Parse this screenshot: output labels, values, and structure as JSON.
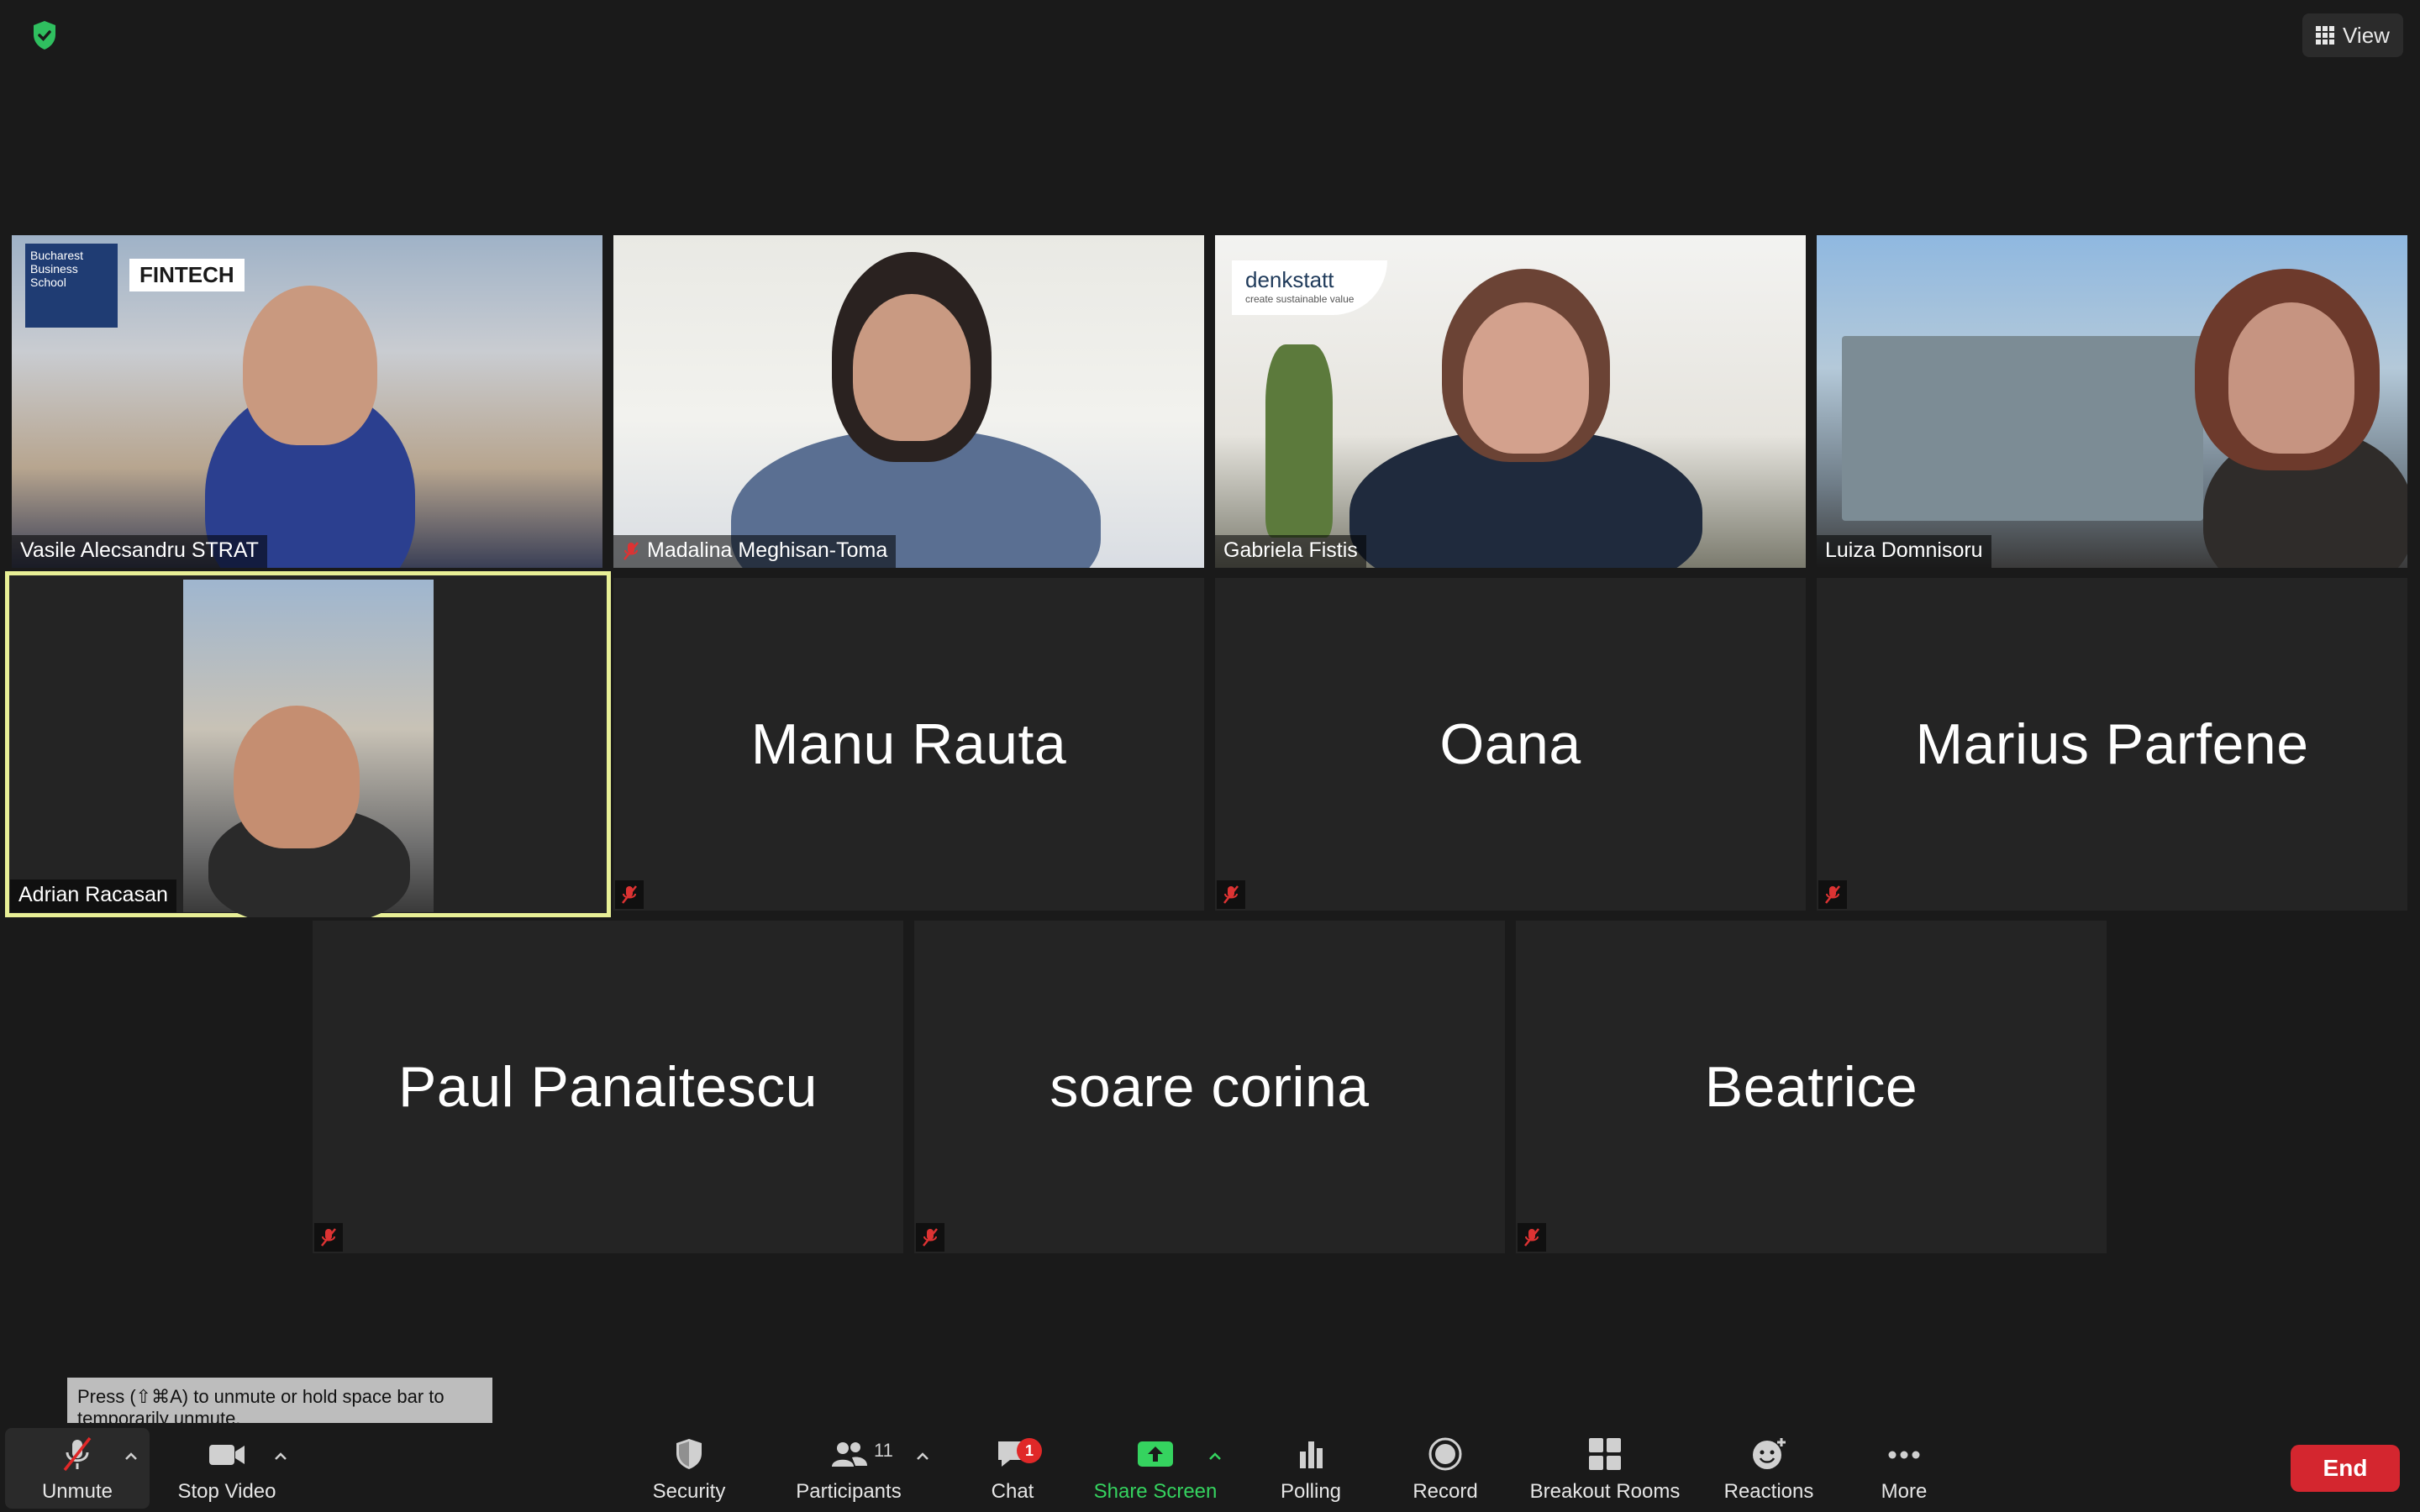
{
  "top": {
    "view_label": "View"
  },
  "participants": [
    {
      "name": "Vasile Alecsandru STRAT",
      "video": true,
      "muted": false
    },
    {
      "name": "Madalina Meghisan-Toma",
      "video": true,
      "muted": true
    },
    {
      "name": "Gabriela Fistis",
      "video": true,
      "muted": false
    },
    {
      "name": "Luiza Domnisoru",
      "video": true,
      "muted": false
    },
    {
      "name": "Adrian Racasan",
      "video": true,
      "muted": false,
      "active_speaker": true
    },
    {
      "name": "Manu Rauta",
      "video": false,
      "muted": true
    },
    {
      "name": "Oana",
      "video": false,
      "muted": true
    },
    {
      "name": "Marius Parfene",
      "video": false,
      "muted": true
    },
    {
      "name": "Paul Panaitescu",
      "video": false,
      "muted": true
    },
    {
      "name": "soare corina",
      "video": false,
      "muted": true
    },
    {
      "name": "Beatrice",
      "video": false,
      "muted": true
    }
  ],
  "video_text": {
    "school_logo": "Bucharest Business School",
    "fintech_logo": "FINTECH",
    "denkstatt_logo": "denkstatt",
    "denkstatt_tagline": "create sustainable value"
  },
  "tooltip": {
    "text": "Press (⇧⌘A) to unmute or hold space bar to temporarily unmute."
  },
  "toolbar": {
    "unmute": "Unmute",
    "stop_video": "Stop Video",
    "security": "Security",
    "participants": "Participants",
    "participants_count": "11",
    "chat": "Chat",
    "chat_badge": "1",
    "share_screen": "Share Screen",
    "polling": "Polling",
    "record": "Record",
    "breakout_rooms": "Breakout Rooms",
    "reactions": "Reactions",
    "more": "More",
    "end": "End"
  },
  "colors": {
    "background": "#1a1a1a",
    "tile": "#242424",
    "active_speaker_border": "#e8ef96",
    "share_green": "#35d35f",
    "end_red": "#d4262f",
    "badge_red": "#e02828",
    "shield_green": "#2fbf5f"
  },
  "icons": [
    "shield-check-icon",
    "grid-icon",
    "mic-off-icon",
    "camera-icon",
    "security-shield-icon",
    "participants-icon",
    "chat-icon",
    "share-screen-icon",
    "polling-icon",
    "record-icon",
    "breakout-rooms-icon",
    "reactions-icon",
    "more-icon",
    "chevron-up-icon"
  ]
}
